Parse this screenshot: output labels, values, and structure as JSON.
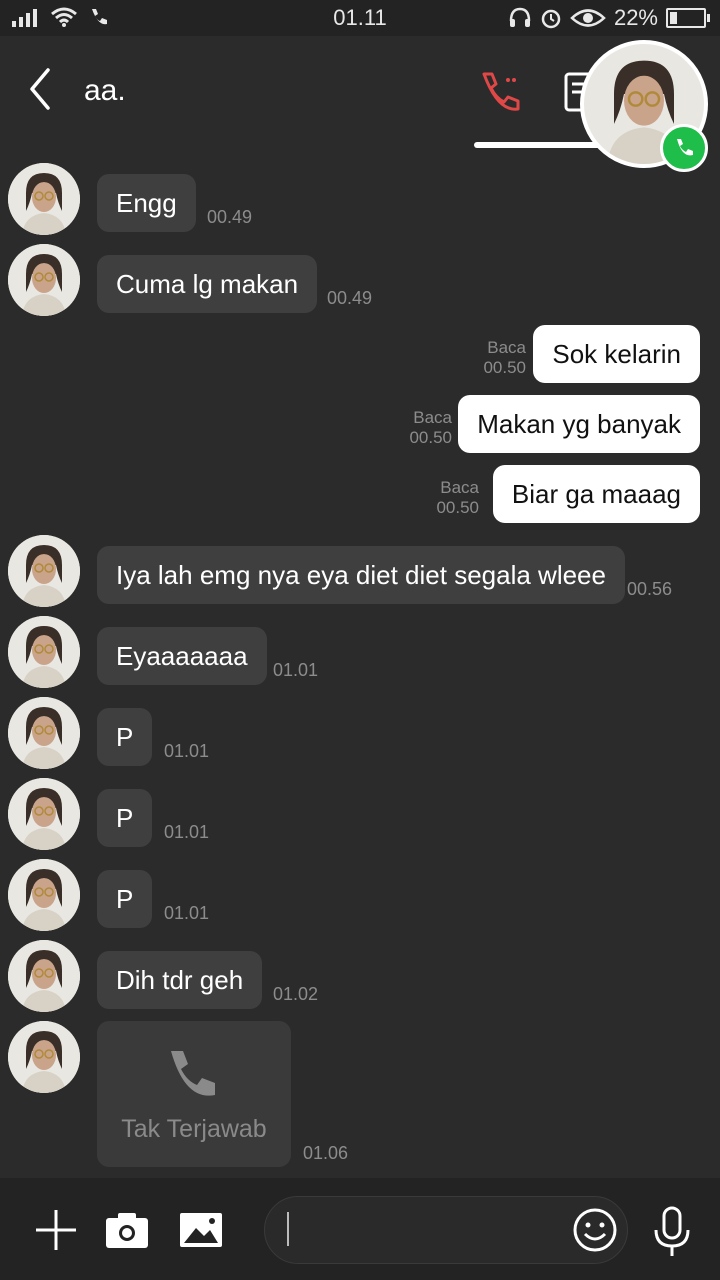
{
  "status_bar": {
    "time": "01.11",
    "battery": "22%"
  },
  "header": {
    "contact_name": "aa."
  },
  "messages": [
    {
      "direction": "in",
      "text": "Engg",
      "time": "00.49"
    },
    {
      "direction": "in",
      "text": "Cuma lg makan",
      "time": "00.49"
    },
    {
      "direction": "out",
      "text": "Sok kelarin",
      "read": "Baca",
      "time": "00.50"
    },
    {
      "direction": "out",
      "text": "Makan yg banyak",
      "read": "Baca",
      "time": "00.50"
    },
    {
      "direction": "out",
      "text": "Biar ga maaag",
      "read": "Baca",
      "time": "00.50"
    },
    {
      "direction": "in",
      "text": "Iya lah emg nya eya diet diet segala wleee",
      "time": "00.56"
    },
    {
      "direction": "in",
      "text": "Eyaaaaaaa",
      "time": "01.01"
    },
    {
      "direction": "in",
      "text": "P",
      "time": "01.01"
    },
    {
      "direction": "in",
      "text": "P",
      "time": "01.01"
    },
    {
      "direction": "in",
      "text": "P",
      "time": "01.01"
    },
    {
      "direction": "in",
      "text": "Dih tdr geh",
      "time": "01.02"
    },
    {
      "direction": "in",
      "type": "missed_call",
      "text": "Tak Terjawab",
      "time": "01.06"
    }
  ],
  "icons": {
    "back": "chevron-left-icon",
    "call": "phone-icon",
    "notes": "notes-icon",
    "add": "plus-icon",
    "camera": "camera-icon",
    "gallery": "image-icon",
    "emoji": "smiley-icon",
    "mic": "microphone-icon"
  },
  "colors": {
    "background": "#2b2b2b",
    "incoming_bubble": "#3f3f3f",
    "outgoing_bubble": "#ffffff",
    "call_accent": "#e04848",
    "call_badge": "#1fbd4a"
  }
}
